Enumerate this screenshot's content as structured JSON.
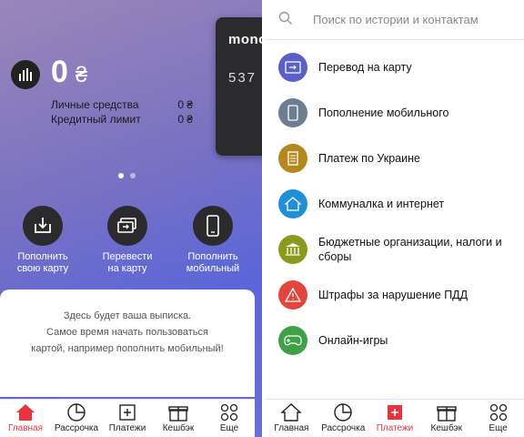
{
  "left": {
    "card": {
      "brand": "mono",
      "number_fragment": "537"
    },
    "balance": {
      "amount": "0",
      "currency": "₴"
    },
    "own_funds": {
      "label": "Личные средства",
      "value": "0 ₴"
    },
    "credit_limit": {
      "label": "Кредитный лимит",
      "value": "0 ₴"
    },
    "actions": [
      {
        "label": "Пополнить\nсвою карту",
        "icon": "download-icon"
      },
      {
        "label": "Перевести\nна карту",
        "icon": "card-transfer-icon"
      },
      {
        "label": "Пополнить\nмобильный",
        "icon": "phone-icon"
      }
    ],
    "statement_text": "Здесь будет ваша выписка.\nСамое время начать пользоваться\nкартой, например пополнить мобильный!",
    "tabs": [
      {
        "label": "Главная",
        "icon": "home-icon",
        "active": true
      },
      {
        "label": "Рассрочка",
        "icon": "pie-chart-icon",
        "active": false
      },
      {
        "label": "Платежи",
        "icon": "payments-icon",
        "active": false
      },
      {
        "label": "Кешбэк",
        "icon": "gift-icon",
        "active": false
      },
      {
        "label": "Еще",
        "icon": "more-icon",
        "active": false
      }
    ]
  },
  "right": {
    "search": {
      "placeholder": "Поиск по истории и контактам"
    },
    "items": [
      {
        "label": "Перевод на карту",
        "icon": "card-transfer-icon",
        "color": "#5b5fc7"
      },
      {
        "label": "Пополнение мобильного",
        "icon": "phone-icon",
        "color": "#6e7d8f"
      },
      {
        "label": "Платеж по Украине",
        "icon": "document-icon",
        "color": "#b5881f"
      },
      {
        "label": "Коммуналка и интернет",
        "icon": "house-icon",
        "color": "#1f8fd6"
      },
      {
        "label": "Бюджетные организации, налоги и сборы",
        "icon": "government-icon",
        "color": "#8a9a1c"
      },
      {
        "label": "Штрафы за нарушение ПДД",
        "icon": "warning-icon",
        "color": "#e2453c"
      },
      {
        "label": "Онлайн-игры",
        "icon": "gamepad-icon",
        "color": "#3fa048"
      }
    ],
    "tabs": [
      {
        "label": "Главная",
        "icon": "home-icon",
        "active": false
      },
      {
        "label": "Рассрочка",
        "icon": "pie-chart-icon",
        "active": false
      },
      {
        "label": "Платежи",
        "icon": "payments-icon",
        "active": true
      },
      {
        "label": "Кешбэк",
        "icon": "gift-icon",
        "active": false
      },
      {
        "label": "Еще",
        "icon": "more-icon",
        "active": false
      }
    ]
  },
  "colors": {
    "accent": "#e7343f",
    "dark": "#2b2b2e"
  }
}
